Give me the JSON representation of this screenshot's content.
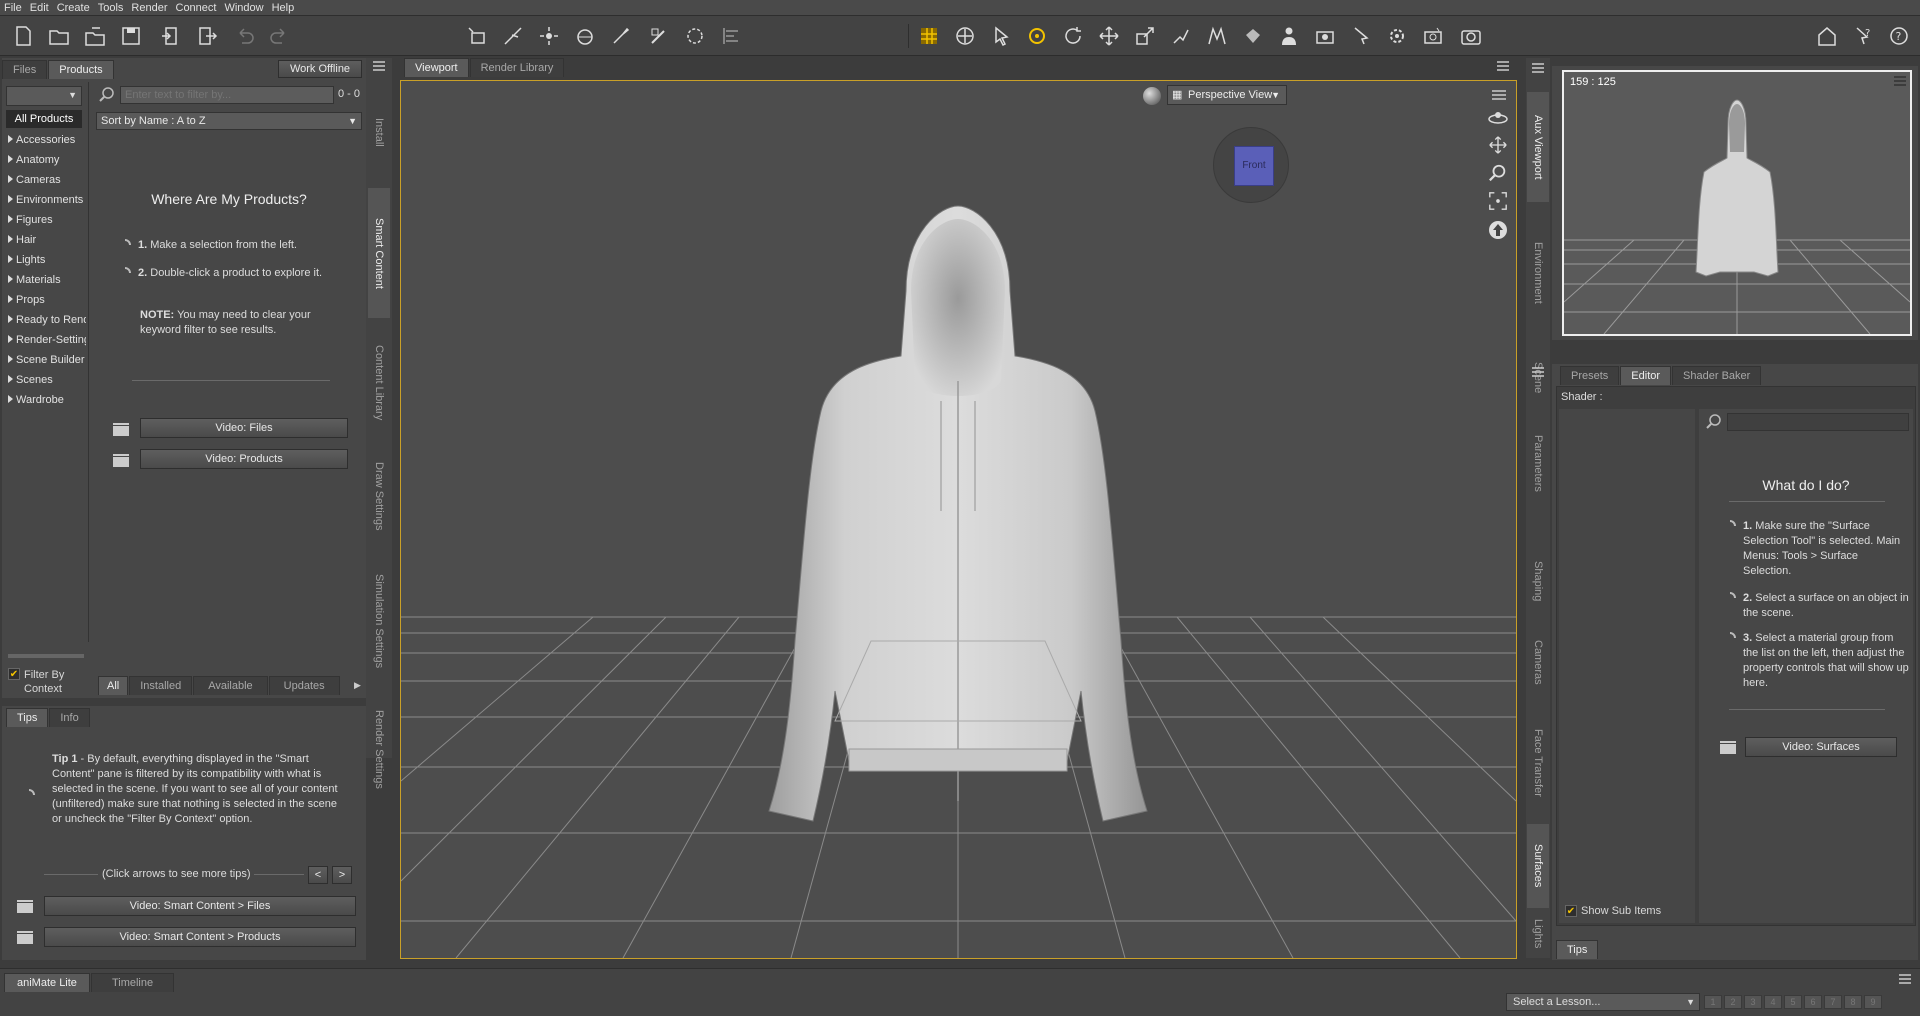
{
  "menu": [
    "File",
    "Edit",
    "Create",
    "Tools",
    "Render",
    "Connect",
    "Window",
    "Help"
  ],
  "left": {
    "tabs": [
      "Files",
      "Products"
    ],
    "work_offline": "Work Offline",
    "filter_placeholder": "Enter text to filter by...",
    "count": "0 - 0",
    "sort": "Sort by Name : A to Z",
    "all_products": "All Products",
    "categories": [
      "Accessories",
      "Anatomy",
      "Cameras",
      "Environments",
      "Figures",
      "Hair",
      "Lights",
      "Materials",
      "Props",
      "Ready to Render",
      "Render-Settings",
      "Scene Builder",
      "Scenes",
      "Wardrobe"
    ],
    "heading": "Where Are My Products?",
    "step1_num": "1.",
    "step1": "Make a selection from the left.",
    "step2_num": "2.",
    "step2": "Double-click a product to explore it.",
    "note_label": "NOTE:",
    "note": "You may need to clear your keyword filter to see results.",
    "video_files": "Video: Files",
    "video_products": "Video: Products",
    "filter_by_context": "Filter By Context",
    "bottom_tabs": [
      "All",
      "Installed",
      "Available",
      "Updates"
    ]
  },
  "side_tabs_left": [
    "Install",
    "Smart Content",
    "Content Library",
    "Draw Settings",
    "Simulation Settings",
    "Render Settings"
  ],
  "tips": {
    "tabs": [
      "Tips",
      "Info"
    ],
    "title": "Tip 1",
    "text": " - By default, everything displayed in the \"Smart Content\" pane is filtered by its compatibility with what is selected in the scene. If you want to see all of your content (unfiltered) make sure that nothing is selected in the scene or uncheck the \"Filter By Context\" option.",
    "click_arrows": "(Click arrows to see more tips)",
    "prev": "<",
    "next": ">",
    "video1": "Video: Smart Content > Files",
    "video2": "Video: Smart Content > Products"
  },
  "viewport": {
    "tabs": [
      "Viewport",
      "Render Library"
    ],
    "view": "Perspective View",
    "cube_label": "Front"
  },
  "aux": {
    "coords": "159 : 125"
  },
  "side_tabs_right_top": [
    "Aux Viewport",
    "Environment",
    "Scene"
  ],
  "side_tabs_right_bottom": [
    "Parameters",
    "Shaping",
    "Cameras",
    "Face Transfer",
    "Surfaces",
    "Lights"
  ],
  "surfaces": {
    "tabs": [
      "Presets",
      "Editor",
      "Shader Baker"
    ],
    "shader_label": "Shader :",
    "heading": "What do I do?",
    "s1_num": "1.",
    "s1": "Make sure the \"Surface Selection Tool\" is selected. Main Menus: Tools > Surface Selection.",
    "s2_num": "2.",
    "s2": "Select a surface on an object in the scene.",
    "s3_num": "3.",
    "s3": "Select a material group from the list on the left, then adjust the property controls that will show up here.",
    "video": "Video: Surfaces",
    "show_sub": "Show Sub Items",
    "tips_tab": "Tips"
  },
  "timeline": {
    "tabs": [
      "aniMate Lite",
      "Timeline"
    ],
    "lesson": "Select a Lesson...",
    "pages": [
      "1",
      "2",
      "3",
      "4",
      "5",
      "6",
      "7",
      "8",
      "9"
    ]
  },
  "colors": {
    "accent": "#f3c300",
    "viewport_border": "#c9a028",
    "cube": "#5a5fb8"
  }
}
